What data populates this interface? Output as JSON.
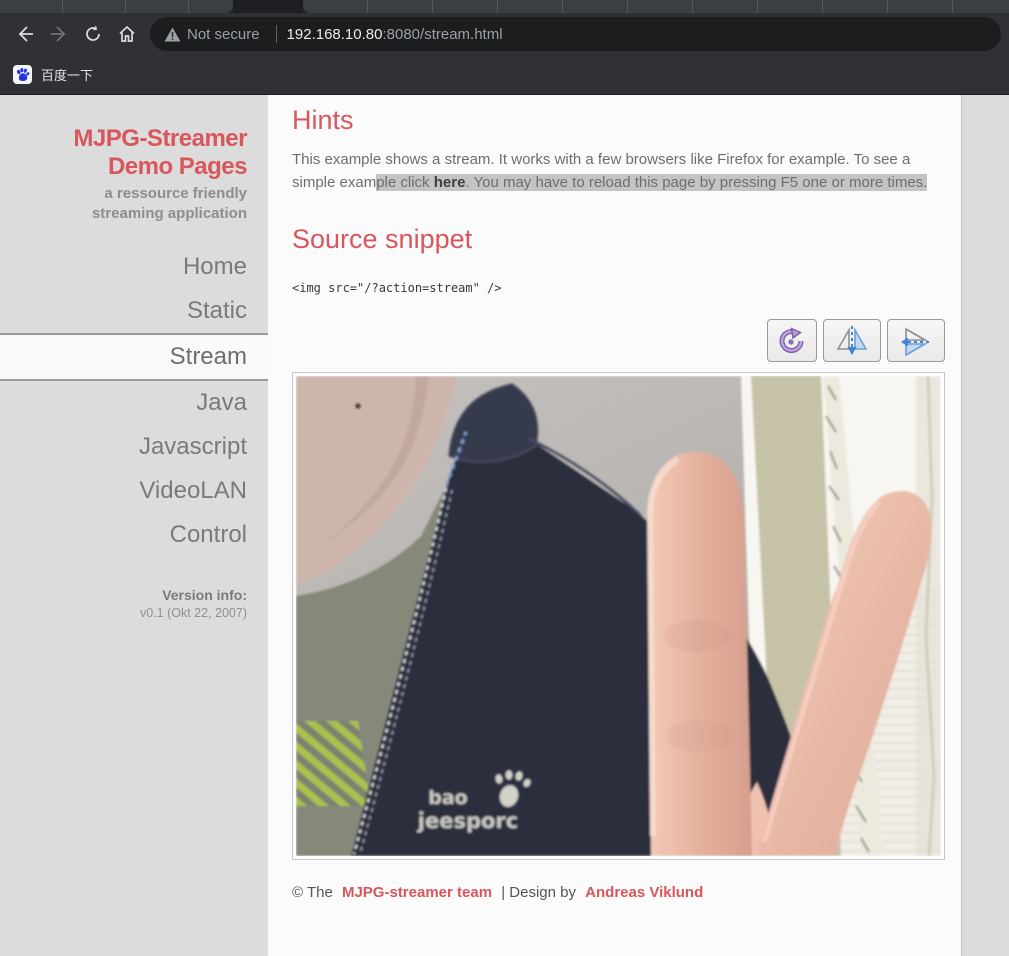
{
  "browser": {
    "security_label": "Not secure",
    "url_host": "192.168.10.80",
    "url_rest": ":8080/stream.html",
    "bookmark_label": "百度一下"
  },
  "sidebar": {
    "title_line1": "MJPG-Streamer",
    "title_line2": "Demo Pages",
    "subtitle_line1": "a ressource friendly",
    "subtitle_line2": "streaming application",
    "nav": [
      {
        "label": "Home"
      },
      {
        "label": "Static"
      },
      {
        "label": "Stream"
      },
      {
        "label": "Java"
      },
      {
        "label": "Javascript"
      },
      {
        "label": "VideoLAN"
      },
      {
        "label": "Control"
      }
    ],
    "active_item": "Stream",
    "version_label": "Version info:",
    "version_value": "v0.1 (Okt 22, 2007)"
  },
  "main": {
    "hints_title": "Hints",
    "hints_text_start": "This example shows a stream. It works with a few browsers like Firefox for example. To see a simple exam",
    "hints_sel_pre": "ple click ",
    "hints_link": "here",
    "hints_sel_post": ". You may have to reload this page by pressing F5 one or more times.",
    "source_title": "Source snippet",
    "source_code": "<img src=\"/?action=stream\" />",
    "controls": [
      {
        "name": "rotate"
      },
      {
        "name": "flip-horizontal"
      },
      {
        "name": "flip-vertical"
      }
    ],
    "stream_logo_line1": "bao",
    "stream_logo_line2": "jeesporc",
    "footer_prefix": "© The",
    "footer_link1": "MJPG-streamer team",
    "footer_middle": "| Design by",
    "footer_link2": "Andreas Viklund"
  },
  "colors": {
    "accent_red": "#d8575c",
    "selection_gray": "#c4c4c4",
    "page_bg": "#dcdcdc",
    "content_bg": "#fbfbfb",
    "chrome_toolbar": "#2f3134",
    "chrome_omnibox": "#1c1d1f",
    "chrome_text": "#9aa0a6",
    "jacket_navy": "#2b2e3d"
  }
}
